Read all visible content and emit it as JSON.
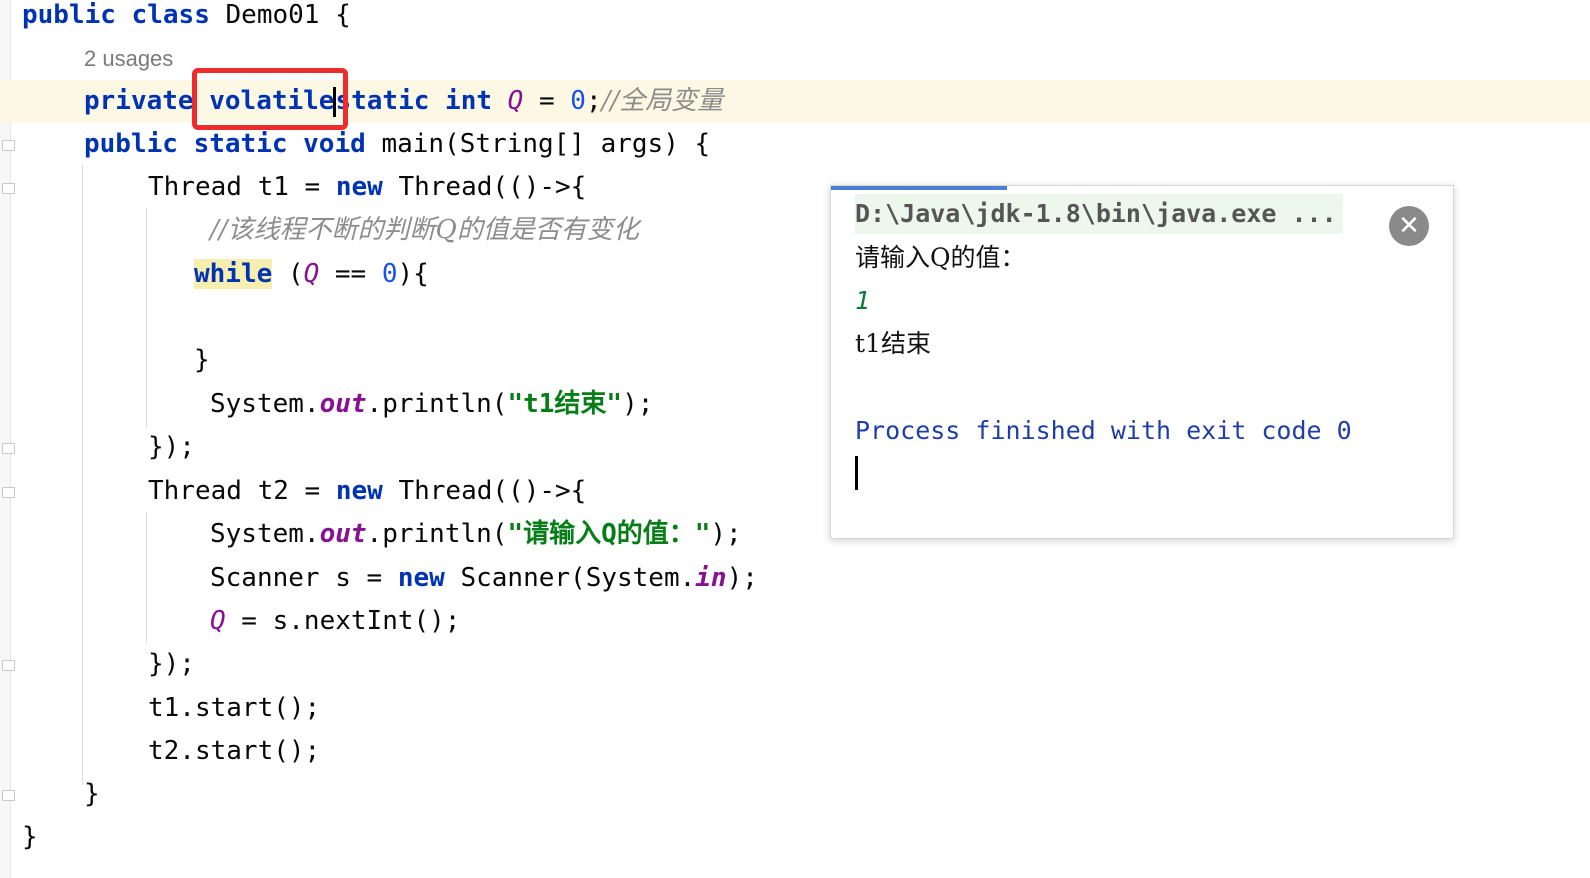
{
  "editor": {
    "usages_hint": "2 usages",
    "lines": {
      "l1": {
        "a": "public",
        "b": "class",
        "c": "Demo01 {"
      },
      "l3": {
        "a": "private",
        "b": "volatile",
        "c": "static",
        "d": "int",
        "e": "Q",
        "f": " = ",
        "g": "0",
        "h": ";",
        "i": "//全局变量"
      },
      "l4": {
        "a": "public",
        "b": "static",
        "c": "void",
        "d": "main(String[] args) {"
      },
      "l5": {
        "a": "Thread t1 = ",
        "b": "new",
        "c": "Thread(()->{"
      },
      "l6": {
        "a": "//该线程不断的判断Q的值是否有变化"
      },
      "l7": {
        "a": "while",
        "b": " (",
        "c": "Q",
        "d": " == ",
        "e": "0",
        "f": "){"
      },
      "l9": {
        "a": "}"
      },
      "l10": {
        "a": "System.",
        "b": "out",
        "c": ".println(",
        "d": "\"t1结束\"",
        "e": ");"
      },
      "l11": {
        "a": "});"
      },
      "l12": {
        "a": "Thread t2 = ",
        "b": "new",
        "c": "Thread(()->{"
      },
      "l13": {
        "a": "System.",
        "b": "out",
        "c": ".println(",
        "d": "\"请输入Q的值：\"",
        "e": ");"
      },
      "l14": {
        "a": "Scanner s = ",
        "b": "new",
        "c": "Scanner(System.",
        "d": "in",
        "e": ");"
      },
      "l15": {
        "a": "Q",
        "b": " = s.nextInt();"
      },
      "l16": {
        "a": "});"
      },
      "l17": {
        "a": "t1.start();"
      },
      "l18": {
        "a": "t2.start();"
      },
      "l19": {
        "a": "}"
      },
      "l20": {
        "a": "}"
      }
    }
  },
  "console": {
    "command": "D:\\Java\\jdk-1.8\\bin\\java.exe ...",
    "prompt": "请输入Q的值：",
    "input": "1",
    "output": "t1结束",
    "exit_message": "Process finished with exit code 0",
    "close_icon": "close-icon"
  },
  "colors": {
    "keyword": "#0033b3",
    "number": "#1750eb",
    "field": "#871094",
    "string": "#067d17",
    "comment": "#8c8c8c",
    "highlight_box": "#ef2b2b"
  }
}
